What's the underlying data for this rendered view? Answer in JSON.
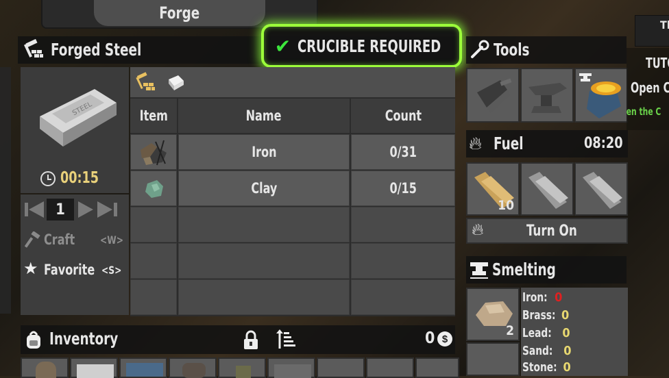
{
  "window_title": "Forge",
  "recipe": {
    "name": "Forged Steel",
    "craft_time": "00:15",
    "quantity": "1",
    "craft_label": "Craft",
    "craft_key": "<W>",
    "favorite_label": "Favorite",
    "favorite_key": "<S>"
  },
  "requirement_banner": "CRUCIBLE REQUIRED",
  "ingredients": {
    "headers": [
      "Item",
      "Name",
      "Count"
    ],
    "rows": [
      {
        "name": "Iron",
        "count": "0/31"
      },
      {
        "name": "Clay",
        "count": "0/15"
      }
    ]
  },
  "tools": {
    "title": "Tools"
  },
  "fuel": {
    "title": "Fuel",
    "time": "08:20",
    "slot1_count": "10",
    "turn_on_label": "Turn On"
  },
  "smelting": {
    "title": "Smelting",
    "slot_count": "2",
    "materials": [
      {
        "label": "Iron:",
        "value": "0",
        "color": "#e02020"
      },
      {
        "label": "Brass:",
        "value": "0",
        "color": "#e8d870"
      },
      {
        "label": "Lead:",
        "value": "0",
        "color": "#e8d870"
      },
      {
        "label": "Sand:",
        "value": "0",
        "color": "#e8d870"
      },
      {
        "label": "Stone:",
        "value": "0",
        "color": "#e8d870"
      }
    ]
  },
  "inventory": {
    "title": "Inventory",
    "currency": "0"
  },
  "tutorial": {
    "header": "Th",
    "title": "TUTO",
    "line1": "Open C",
    "line2": "pen the C"
  }
}
